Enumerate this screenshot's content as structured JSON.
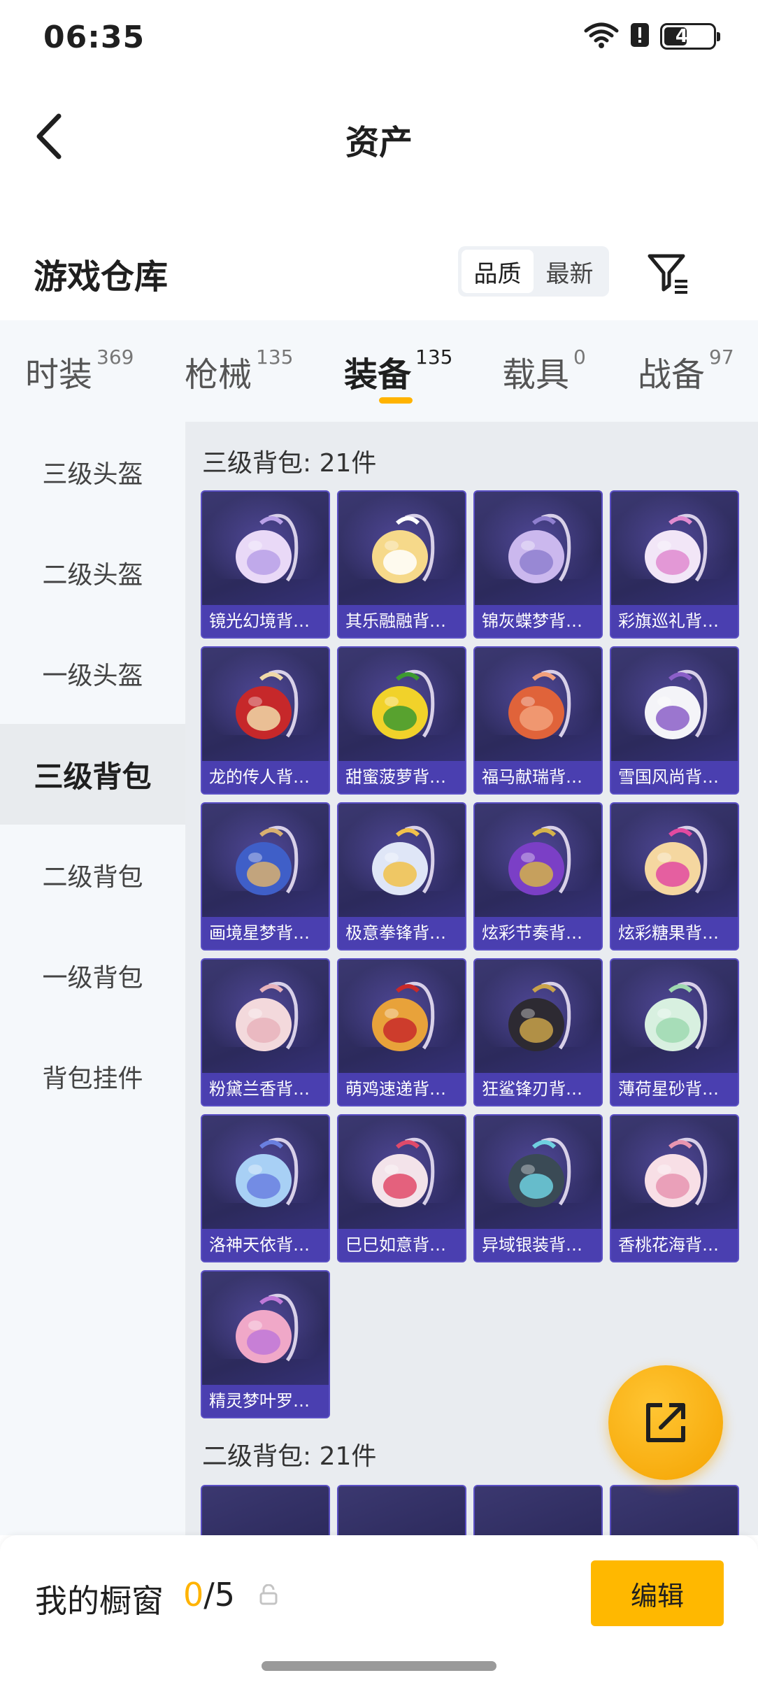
{
  "status_bar": {
    "time": "06:35",
    "battery": "43",
    "battery_level": 0.43
  },
  "nav": {
    "title": "资产"
  },
  "header": {
    "title": "游戏仓库",
    "sort_options": [
      "品质",
      "最新"
    ],
    "active_sort": 0
  },
  "tabs": [
    {
      "label": "时装",
      "count": "369"
    },
    {
      "label": "枪械",
      "count": "135"
    },
    {
      "label": "装备",
      "count": "135"
    },
    {
      "label": "载具",
      "count": "0"
    },
    {
      "label": "战备",
      "count": "97"
    }
  ],
  "active_tab": 2,
  "sidebar": {
    "items": [
      "三级头盔",
      "二级头盔",
      "一级头盔",
      "三级背包",
      "二级背包",
      "一级背包",
      "背包挂件"
    ],
    "active": 3
  },
  "groups": [
    {
      "title": "三级背包: 21件",
      "items": [
        {
          "name": "镜光幻境背…",
          "colors": [
            "#e9d9f7",
            "#b9a0e8"
          ]
        },
        {
          "name": "其乐融融背…",
          "colors": [
            "#f6d98a",
            "#ffffff"
          ]
        },
        {
          "name": "锦灰蝶梦背…",
          "colors": [
            "#cbb8ee",
            "#8f7fcf"
          ]
        },
        {
          "name": "彩旗巡礼背…",
          "colors": [
            "#f2e6f7",
            "#e18ad0"
          ]
        },
        {
          "name": "龙的传人背…",
          "colors": [
            "#c6282a",
            "#f0d9a8"
          ]
        },
        {
          "name": "甜蜜菠萝背…",
          "colors": [
            "#f1d22a",
            "#3d9a30"
          ]
        },
        {
          "name": "福马献瑞背…",
          "colors": [
            "#e0633a",
            "#f2a07a"
          ]
        },
        {
          "name": "雪国风尚背…",
          "colors": [
            "#f4f4f8",
            "#8b5fc8"
          ]
        },
        {
          "name": "画境星梦背…",
          "colors": [
            "#3f5fc8",
            "#d9b070"
          ]
        },
        {
          "name": "极意拳锋背…",
          "colors": [
            "#dfe6f7",
            "#f2c14a"
          ]
        },
        {
          "name": "炫彩节奏背…",
          "colors": [
            "#7b3fc6",
            "#d4b24a"
          ]
        },
        {
          "name": "炫彩糖果背…",
          "colors": [
            "#f5d7a0",
            "#e24aa0"
          ]
        },
        {
          "name": "粉黛兰香背…",
          "colors": [
            "#f3d9dc",
            "#e8b3bc"
          ]
        },
        {
          "name": "萌鸡速递背…",
          "colors": [
            "#e8a23a",
            "#c82a2a"
          ]
        },
        {
          "name": "狂鲨锋刃背…",
          "colors": [
            "#2d2a32",
            "#c9a24a"
          ]
        },
        {
          "name": "薄荷星砂背…",
          "colors": [
            "#d8f0e0",
            "#9fd9b0"
          ]
        },
        {
          "name": "洛神天依背…",
          "colors": [
            "#a8d0f5",
            "#6a80e0"
          ]
        },
        {
          "name": "巳巳如意背…",
          "colors": [
            "#f3e3ea",
            "#e04a6a"
          ]
        },
        {
          "name": "异域银装背…",
          "colors": [
            "#3a4a55",
            "#6fd0e0"
          ]
        },
        {
          "name": "香桃花海背…",
          "colors": [
            "#f8dfe6",
            "#e895b0"
          ]
        },
        {
          "name": "精灵梦叶罗…",
          "colors": [
            "#f0a8c8",
            "#c078d8"
          ]
        }
      ]
    },
    {
      "title": "二级背包: 21件"
    }
  ],
  "bottom_bar": {
    "label": "我的橱窗",
    "current": "0",
    "total": "/5",
    "edit_label": "编辑"
  }
}
